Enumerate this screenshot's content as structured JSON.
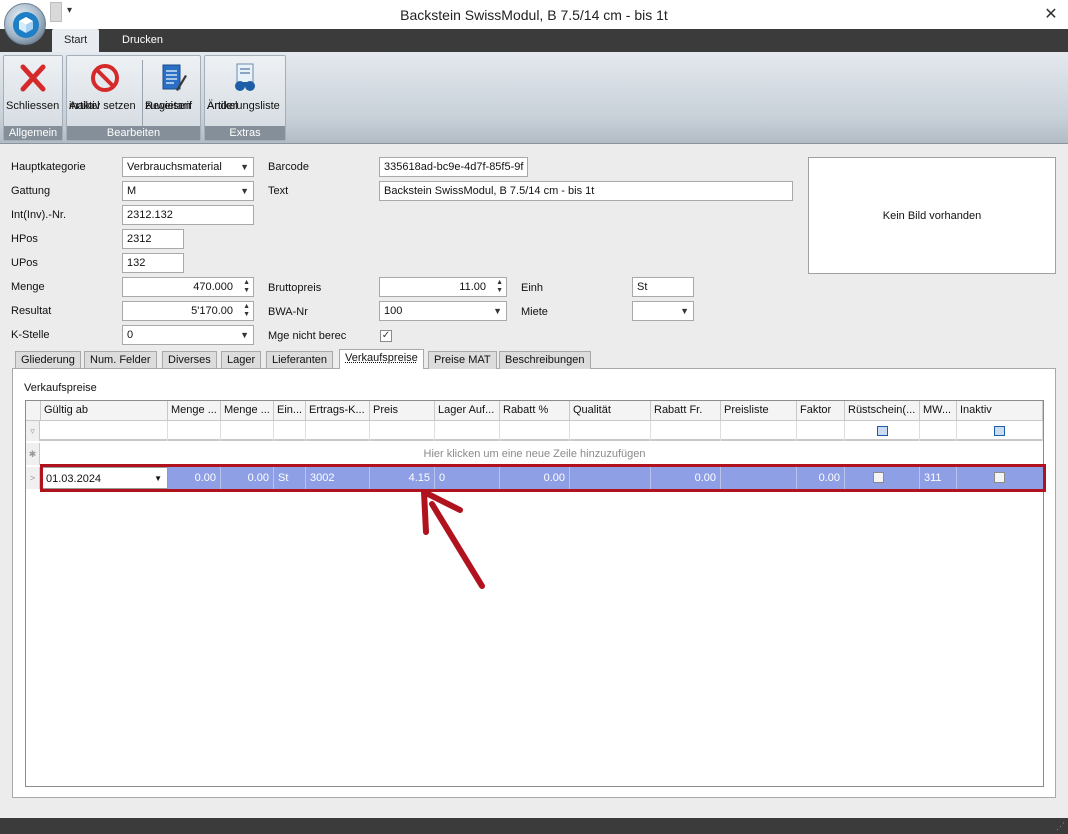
{
  "window": {
    "title": "Backstein SwissModul, B 7.5/14 cm - bis 1t",
    "close_glyph": "✕",
    "qat_glyph": "▾"
  },
  "ribbon": {
    "tabs": [
      {
        "label": "Start"
      },
      {
        "label": "Drucken"
      }
    ],
    "groups": {
      "allgemein": {
        "caption": "Allgemein",
        "schliessen": "Schliessen"
      },
      "bearbeiten": {
        "caption": "Bearbeiten",
        "inaktiv_1": "Artikel",
        "inaktiv_2": "inaktiv setzen",
        "regie_1": "Regietarif",
        "regie_2": "zuweisen"
      },
      "extras": {
        "caption": "Extras",
        "aend_1": "Artikel",
        "aend_2": "Änderungsliste"
      }
    }
  },
  "form": {
    "hauptkategorie": {
      "label": "Hauptkategorie",
      "value": "Verbrauchsmaterial"
    },
    "gattung": {
      "label": "Gattung",
      "value": "M"
    },
    "intnr": {
      "label": "Int(Inv).-Nr.",
      "value": "2312.132"
    },
    "hpos": {
      "label": "HPos",
      "value": "2312"
    },
    "upos": {
      "label": "UPos",
      "value": "132"
    },
    "menge": {
      "label": "Menge",
      "value": "470.000"
    },
    "resultat": {
      "label": "Resultat",
      "value": "5'170.00"
    },
    "kstelle": {
      "label": "K-Stelle",
      "value": "0"
    },
    "barcode": {
      "label": "Barcode",
      "value": "335618ad-bc9e-4d7f-85f5-9f"
    },
    "text": {
      "label": "Text",
      "value": "Backstein SwissModul, B 7.5/14 cm - bis 1t"
    },
    "bruttopreis": {
      "label": "Bruttopreis",
      "value": "11.00"
    },
    "bwanr": {
      "label": "BWA-Nr",
      "value": "100"
    },
    "mge_nicht_berec": {
      "label": "Mge nicht berec",
      "checked": true
    },
    "einh": {
      "label": "Einh",
      "value": "St"
    },
    "miete": {
      "label": "Miete",
      "value": ""
    },
    "image_placeholder": "Kein Bild vorhanden"
  },
  "subtabs": [
    "Gliederung",
    "Num. Felder",
    "Diverses",
    "Lager",
    "Lieferanten",
    "Verkaufspreise",
    "Preise MAT",
    "Beschreibungen"
  ],
  "active_subtab": "Verkaufspreise",
  "panel": {
    "title": "Verkaufspreise"
  },
  "grid": {
    "columns": [
      "Gültig ab",
      "Menge ...",
      "Menge ...",
      "Ein...",
      "Ertrags-K...",
      "Preis",
      "Lager Auf...",
      "Rabatt %",
      "Qualität",
      "Rabatt Fr.",
      "Preisliste",
      "Faktor",
      "Rüstschein(...",
      "MW...",
      "Inaktiv"
    ],
    "new_row_hint": "Hier klicken um eine neue Zeile hinzuzufügen",
    "rows": [
      {
        "gueltig_ab": "01.03.2024",
        "menge1": "0.00",
        "menge2": "0.00",
        "einh": "St",
        "ertragsk": "3002",
        "preis": "4.15",
        "lager": "0",
        "rabatt_pct": "0.00",
        "qualitaet": "",
        "rabatt_fr": "0.00",
        "preisliste": "",
        "faktor": "0.00",
        "ruestschein": false,
        "mw": "311",
        "inaktiv": false
      }
    ]
  },
  "annotation": {
    "color": "#b0121e"
  }
}
